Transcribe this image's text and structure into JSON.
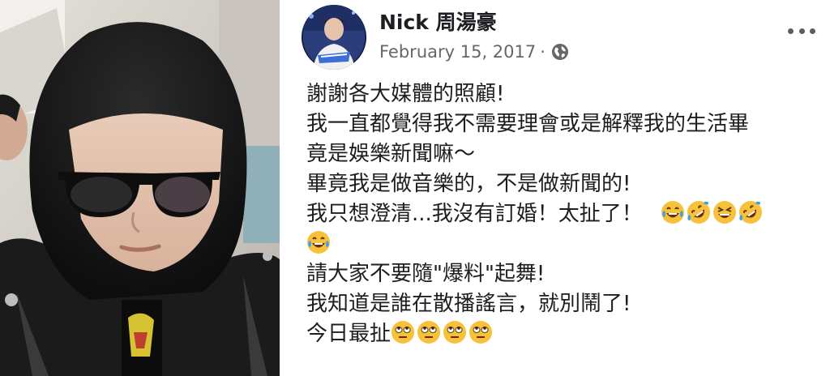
{
  "post": {
    "author": "Nick 周湯豪",
    "date": "February 15, 2017",
    "separator": "·",
    "privacy_icon": "globe-icon",
    "more_icon": "more-options-icon",
    "lines": {
      "l1": "謝謝各大媒體的照顧!",
      "l2": "我一直都覺得我不需要理會或是解釋我的生活畢",
      "l3": "竟是娛樂新聞嘛～",
      "l4": "畢竟我是做音樂的，不是做新聞的!",
      "l5": "我只想澄清...我沒有訂婚！太扯了！",
      "l7": "請大家不要隨\"爆料\"起舞!",
      "l8": "我知道是誰在散播謠言，就別鬧了!",
      "l9": "今日最扯"
    },
    "emoji": {
      "laughing": "laughing-tears-emoji",
      "rolling": "rolling-laughing-emoji",
      "grin": "grinning-squint-emoji",
      "eyeroll": "eye-roll-emoji"
    }
  },
  "colors": {
    "text": "#1c1e21",
    "meta": "#65676b",
    "emoji_face": "#f7c23a"
  }
}
